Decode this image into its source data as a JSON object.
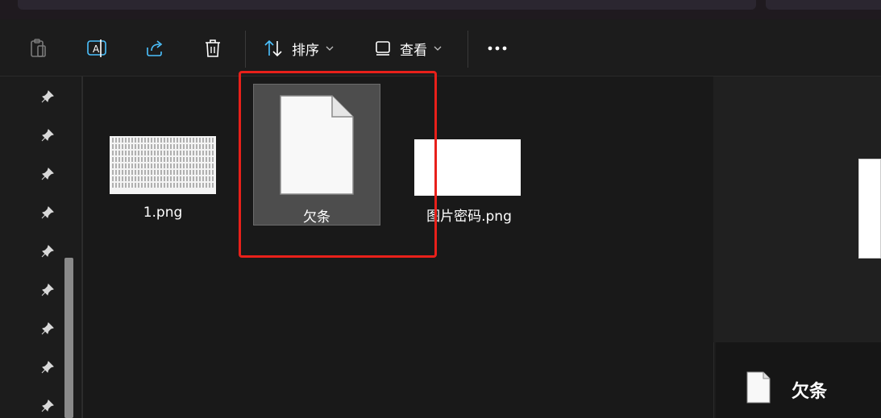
{
  "toolbar": {
    "sort_label": "排序",
    "view_label": "查看",
    "more_label": "•••"
  },
  "files": [
    {
      "name": "1.png",
      "type": "image-thumbnail-text"
    },
    {
      "name": "欠条",
      "type": "document",
      "selected": true
    },
    {
      "name": "图片密码.png",
      "type": "image-thumbnail-white"
    }
  ],
  "preview": {
    "title": "欠条"
  },
  "colors": {
    "highlight": "#e8201a",
    "selected_bg": "#4d4d4d",
    "background": "#191919",
    "accent_icon": "#4cc2ff"
  }
}
